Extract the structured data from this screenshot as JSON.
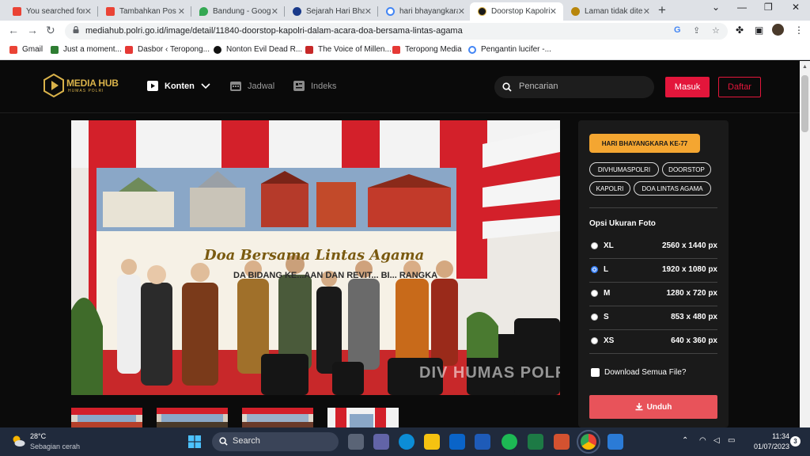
{
  "browser": {
    "tabs": [
      {
        "title": "You searched for",
        "favicon": "gmail-icon",
        "color": "#ea4335"
      },
      {
        "title": "Tambahkan Pos B",
        "favicon": "gmail-icon",
        "color": "#ea4335"
      },
      {
        "title": "Bandung - Google",
        "favicon": "maps-icon",
        "color": "#34a853"
      },
      {
        "title": "Sejarah Hari Bhay",
        "favicon": "news-icon",
        "color": "#1a3a8a"
      },
      {
        "title": "hari bhayangkara",
        "favicon": "google-icon",
        "color": "#4285f4"
      },
      {
        "title": "Doorstop Kapolri",
        "favicon": "mediahub-icon",
        "color": "#1a1a1a"
      },
      {
        "title": "Laman tidak ditem",
        "favicon": "polri-icon",
        "color": "#b8860b"
      }
    ],
    "url": "mediahub.polri.go.id/image/detail/11840-doorstop-kapolri-dalam-acara-doa-bersama-lintas-agama",
    "bookmarks": [
      {
        "label": "Gmail",
        "color": "#ea4335"
      },
      {
        "label": "Just a moment...",
        "color": "#2e7d32"
      },
      {
        "label": "Dasbor ‹ Teropong...",
        "color": "#e53935"
      },
      {
        "label": "Nonton Evil Dead R...",
        "color": "#111111"
      },
      {
        "label": "The Voice of Millen...",
        "color": "#c62828"
      },
      {
        "label": "Teropong Media",
        "color": "#e53935"
      },
      {
        "label": "Pengantin lucifer -...",
        "color": "#4285f4"
      }
    ]
  },
  "site": {
    "logo": {
      "text": "MEDIA HUB",
      "sub": "HUMAS POLRI"
    },
    "nav": [
      {
        "label": "Konten",
        "icon": "play-icon"
      },
      {
        "label": "Jadwal",
        "icon": "calendar-icon"
      },
      {
        "label": "Indeks",
        "icon": "index-icon"
      }
    ],
    "search_placeholder": "Pencarian",
    "login_label": "Masuk",
    "register_label": "Daftar"
  },
  "photo": {
    "banner_title": "Doa Bersama Lintas Agama",
    "banner_sub": "DA BIDANG KE...AAN DAN REVIT... BI... RANGKA",
    "watermark": "DIV HUMAS POLRI"
  },
  "panel": {
    "category_tag": "HARI BHAYANGKARA KE-77",
    "tags": [
      "DIVHUMASPOLRI",
      "DOORSTOP",
      "KAPOLRI",
      "DOA LINTAS AGAMA"
    ],
    "options_title": "Opsi Ukuran Foto",
    "options": [
      {
        "name": "XL",
        "size": "2560 x 1440 px",
        "checked": false
      },
      {
        "name": "L",
        "size": "1920 x 1080 px",
        "checked": true
      },
      {
        "name": "M",
        "size": "1280 x 720 px",
        "checked": false
      },
      {
        "name": "S",
        "size": "853 x 480 px",
        "checked": false
      },
      {
        "name": "XS",
        "size": "640 x 360 px",
        "checked": false
      }
    ],
    "download_all_label": "Download Semua File?",
    "download_button": "Unduh"
  },
  "taskbar": {
    "temperature": "28°C",
    "weather": "Sebagian cerah",
    "search_placeholder": "Search",
    "time": "11:34",
    "date": "01/07/2023",
    "notifications": "3"
  },
  "colors": {
    "accent_red": "#e3163b",
    "tag_orange": "#f4a631",
    "download_red": "#e8535a"
  }
}
